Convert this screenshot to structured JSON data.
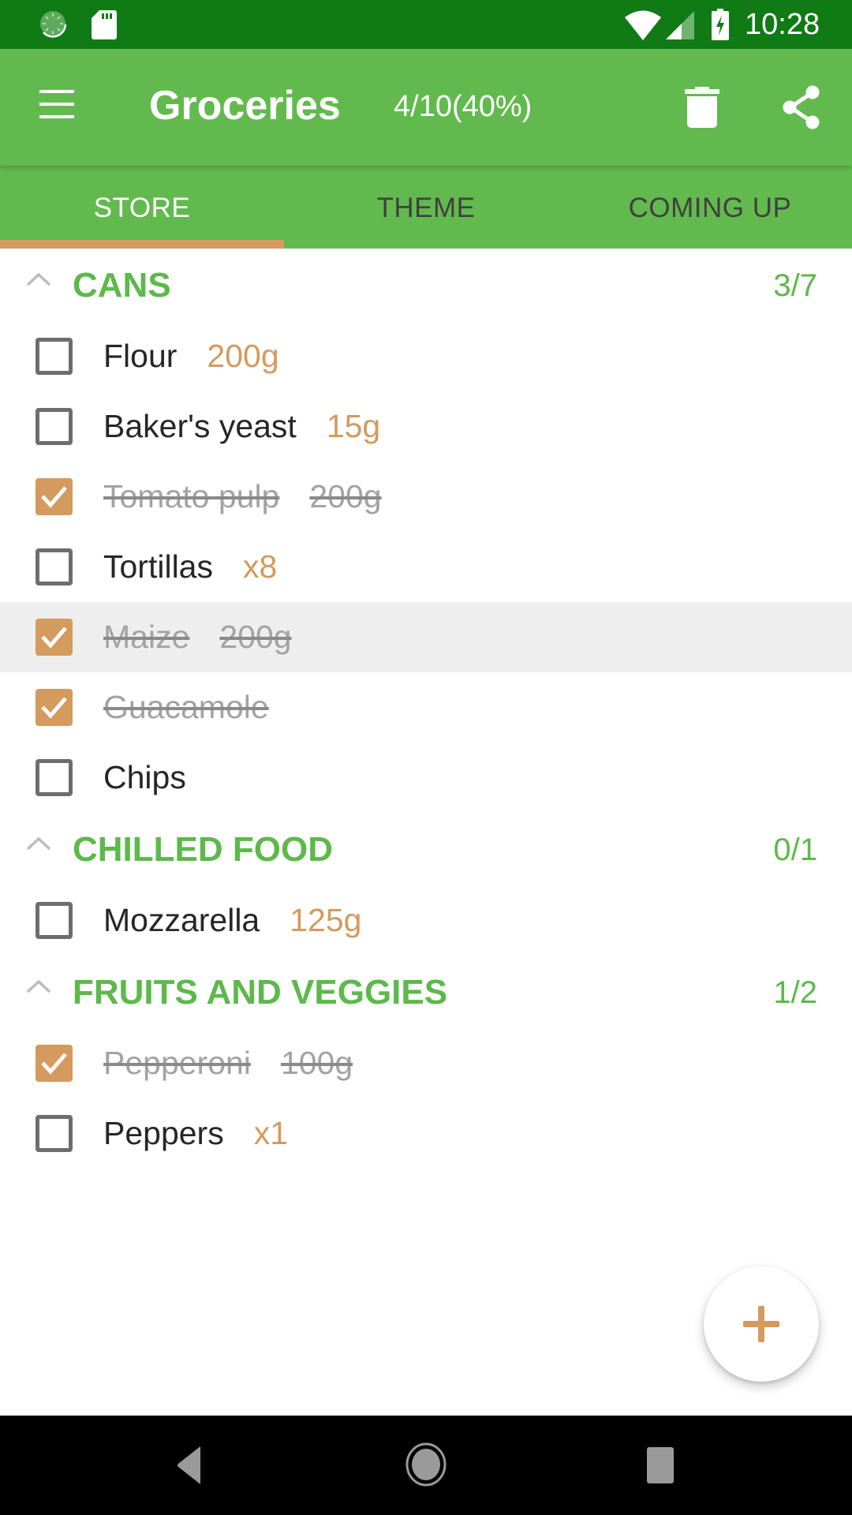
{
  "status_bar": {
    "time": "10:28",
    "left_icons": [
      "sync-icon",
      "sd-card-icon"
    ],
    "right_icons": [
      "wifi-icon",
      "cell-signal-icon",
      "battery-charging-icon"
    ]
  },
  "app_bar": {
    "menu_icon": "hamburger-menu-icon",
    "title": "Groceries",
    "progress": "4/10(40%)",
    "actions": [
      {
        "name": "delete",
        "icon": "trash-icon"
      },
      {
        "name": "share",
        "icon": "share-icon"
      }
    ]
  },
  "tabs": [
    {
      "label": "STORE",
      "active": true
    },
    {
      "label": "THEME",
      "active": false
    },
    {
      "label": "COMING UP",
      "active": false
    }
  ],
  "colors": {
    "primary": "#62BA4E",
    "primary_dark": "#107A15",
    "accent": "#D49A5E",
    "section_title": "#5CB94A",
    "done_text": "#A3A3A3"
  },
  "sections": [
    {
      "title": "CANS",
      "count": "3/7",
      "expanded": true,
      "items": [
        {
          "name": "Flour",
          "qty": "200g",
          "checked": false
        },
        {
          "name": "Baker's yeast",
          "qty": "15g",
          "checked": false
        },
        {
          "name": "Tomato pulp",
          "qty": "200g",
          "checked": true
        },
        {
          "name": "Tortillas",
          "qty": "x8",
          "checked": false
        },
        {
          "name": "Maize",
          "qty": "200g",
          "checked": true,
          "highlighted": true
        },
        {
          "name": "Guacamole",
          "qty": "",
          "checked": true
        },
        {
          "name": "Chips",
          "qty": "",
          "checked": false
        }
      ]
    },
    {
      "title": "CHILLED FOOD",
      "count": "0/1",
      "expanded": true,
      "items": [
        {
          "name": "Mozzarella",
          "qty": "125g",
          "checked": false
        }
      ]
    },
    {
      "title": "FRUITS AND VEGGIES",
      "count": "1/2",
      "expanded": true,
      "items": [
        {
          "name": "Pepperoni",
          "qty": "100g",
          "checked": true
        },
        {
          "name": "Peppers",
          "qty": "x1",
          "checked": false
        }
      ]
    }
  ],
  "fab": {
    "icon": "plus-icon"
  },
  "nav_bar": {
    "buttons": [
      "back-icon",
      "home-icon",
      "recents-icon"
    ]
  }
}
